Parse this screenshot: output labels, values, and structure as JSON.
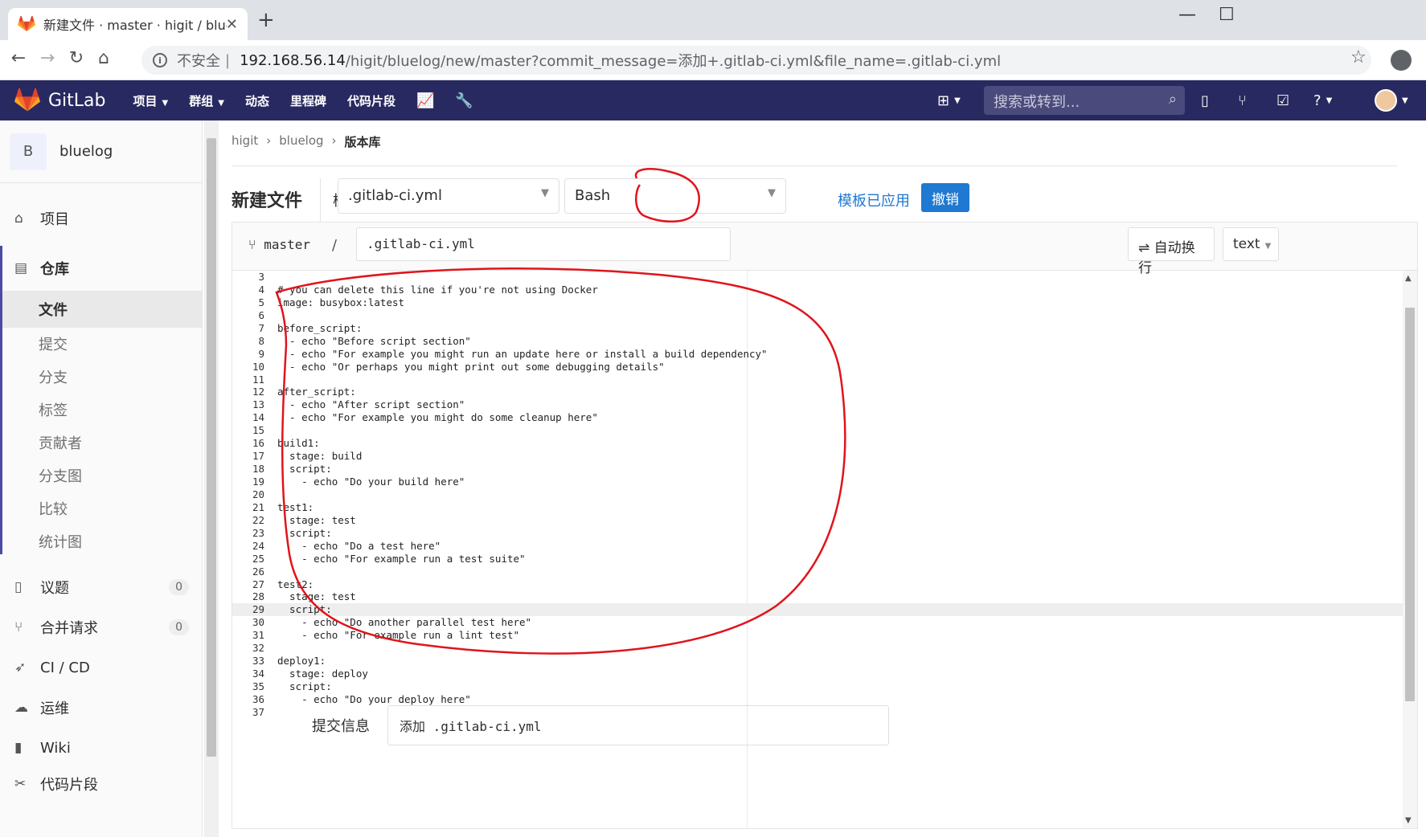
{
  "browser": {
    "tab_title": "新建文件 · master · higit / bluel",
    "url_insecure": "不安全",
    "url_host": "192.168.56.14",
    "url_path": "/higit/bluelog/new/master?commit_message=添加+.gitlab-ci.yml&file_name=.gitlab-ci.yml"
  },
  "header": {
    "brand": "GitLab",
    "menus": [
      "项目",
      "群组",
      "动态",
      "里程碑",
      "代码片段"
    ],
    "search_placeholder": "搜索或转到..."
  },
  "sidebar": {
    "project_initial": "B",
    "project_name": "bluelog",
    "items": [
      {
        "label": "项目",
        "icon": "home-icon"
      },
      {
        "label": "仓库",
        "icon": "book-icon"
      },
      {
        "label": "议题",
        "icon": "issues-icon",
        "badge": "0"
      },
      {
        "label": "合并请求",
        "icon": "merge-request-icon",
        "badge": "0"
      },
      {
        "label": "CI / CD",
        "icon": "rocket-icon"
      },
      {
        "label": "运维",
        "icon": "cloud-gear-icon"
      },
      {
        "label": "Wiki",
        "icon": "book-open-icon"
      },
      {
        "label": "代码片段",
        "icon": "snippet-icon"
      }
    ],
    "repo_sub": [
      "文件",
      "提交",
      "分支",
      "标签",
      "贡献者",
      "分支图",
      "比较",
      "统计图"
    ]
  },
  "breadcrumb": [
    "higit",
    "bluelog",
    "版本库"
  ],
  "page": {
    "title": "新建文件",
    "template_label": "模板",
    "template_type": ".gitlab-ci.yml",
    "template_name": "Bash",
    "applied_text": "模板已应用",
    "cancel_label": "撤销"
  },
  "editor": {
    "branch": "master",
    "slash": "/",
    "file_name": ".gitlab-ci.yml",
    "wrap_label": "自动换行",
    "mode": "text",
    "first_line_number": 3,
    "current_line": 29,
    "lines": [
      "",
      "# you can delete this line if you're not using Docker",
      "image: busybox:latest",
      "",
      "before_script:",
      "  - echo \"Before script section\"",
      "  - echo \"For example you might run an update here or install a build dependency\"",
      "  - echo \"Or perhaps you might print out some debugging details\"",
      "",
      "after_script:",
      "  - echo \"After script section\"",
      "  - echo \"For example you might do some cleanup here\"",
      "",
      "build1:",
      "  stage: build",
      "  script:",
      "    - echo \"Do your build here\"",
      "",
      "test1:",
      "  stage: test",
      "  script:",
      "    - echo \"Do a test here\"",
      "    - echo \"For example run a test suite\"",
      "",
      "test2:",
      "  stage: test",
      "  script:",
      "    - echo \"Do another parallel test here\"",
      "    - echo \"For example run a lint test\"",
      "",
      "deploy1:",
      "  stage: deploy",
      "  script:",
      "    - echo \"Do your deploy here\"",
      ""
    ]
  },
  "commit": {
    "label": "提交信息",
    "value": "添加 .gitlab-ci.yml"
  },
  "colors": {
    "header_bg": "#292961",
    "primary_button": "#1f78d1",
    "annotation": "#e0141c"
  }
}
